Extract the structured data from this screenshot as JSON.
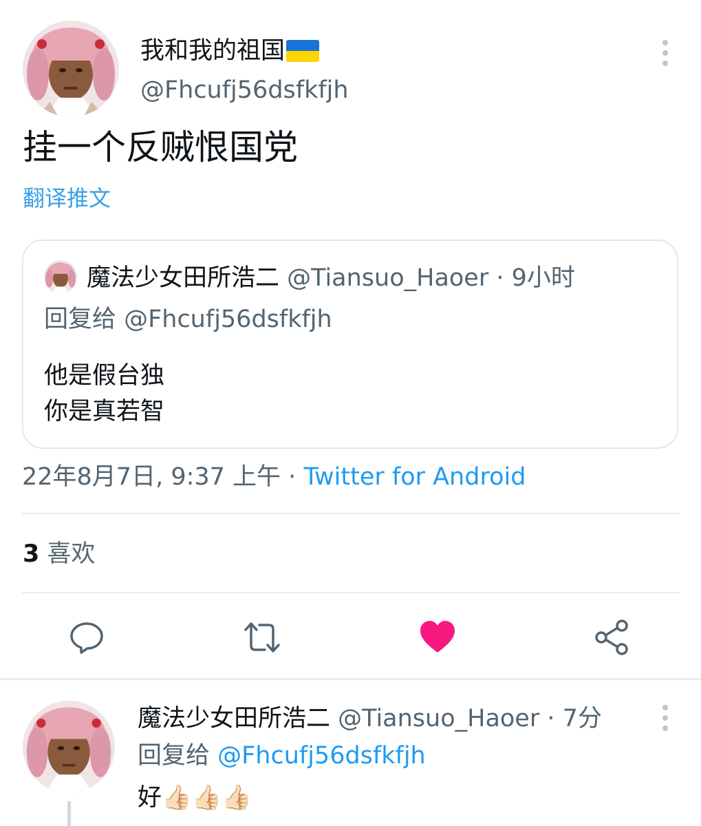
{
  "main_tweet": {
    "display_name": "我和我的祖国",
    "name_flag": "ukraine-flag",
    "handle": "@Fhcufj56dsfkfjh",
    "text": "挂一个反贼恨国党",
    "translate_link": "翻译推文",
    "timestamp": "22年8月7日, 9:37 上午",
    "separator": " · ",
    "source": "Twitter for Android",
    "likes_count": "3",
    "likes_label": "喜欢"
  },
  "quoted_tweet": {
    "display_name": "魔法少女田所浩二",
    "meta": " @Tiansuo_Haoer · 9小时",
    "reply_to": "回复给 @Fhcufj56dsfkfjh",
    "line1": "他是假台独",
    "line2": "你是真若智"
  },
  "reply_tweet": {
    "display_name": "魔法少女田所浩二",
    "meta": " @Tiansuo_Haoer · 7分",
    "reply_prefix": "回复给 ",
    "reply_mention": "@Fhcufj56dsfkfjh",
    "text": "好👍🏻👍🏻👍🏻"
  },
  "actions": [
    {
      "icon": "reply-icon"
    },
    {
      "icon": "retweet-icon"
    },
    {
      "icon": "heart-icon",
      "active": true
    },
    {
      "icon": "share-icon"
    }
  ],
  "colors": {
    "accent": "#1d9bf0",
    "like": "#f91880",
    "secondary_text": "#536471"
  }
}
